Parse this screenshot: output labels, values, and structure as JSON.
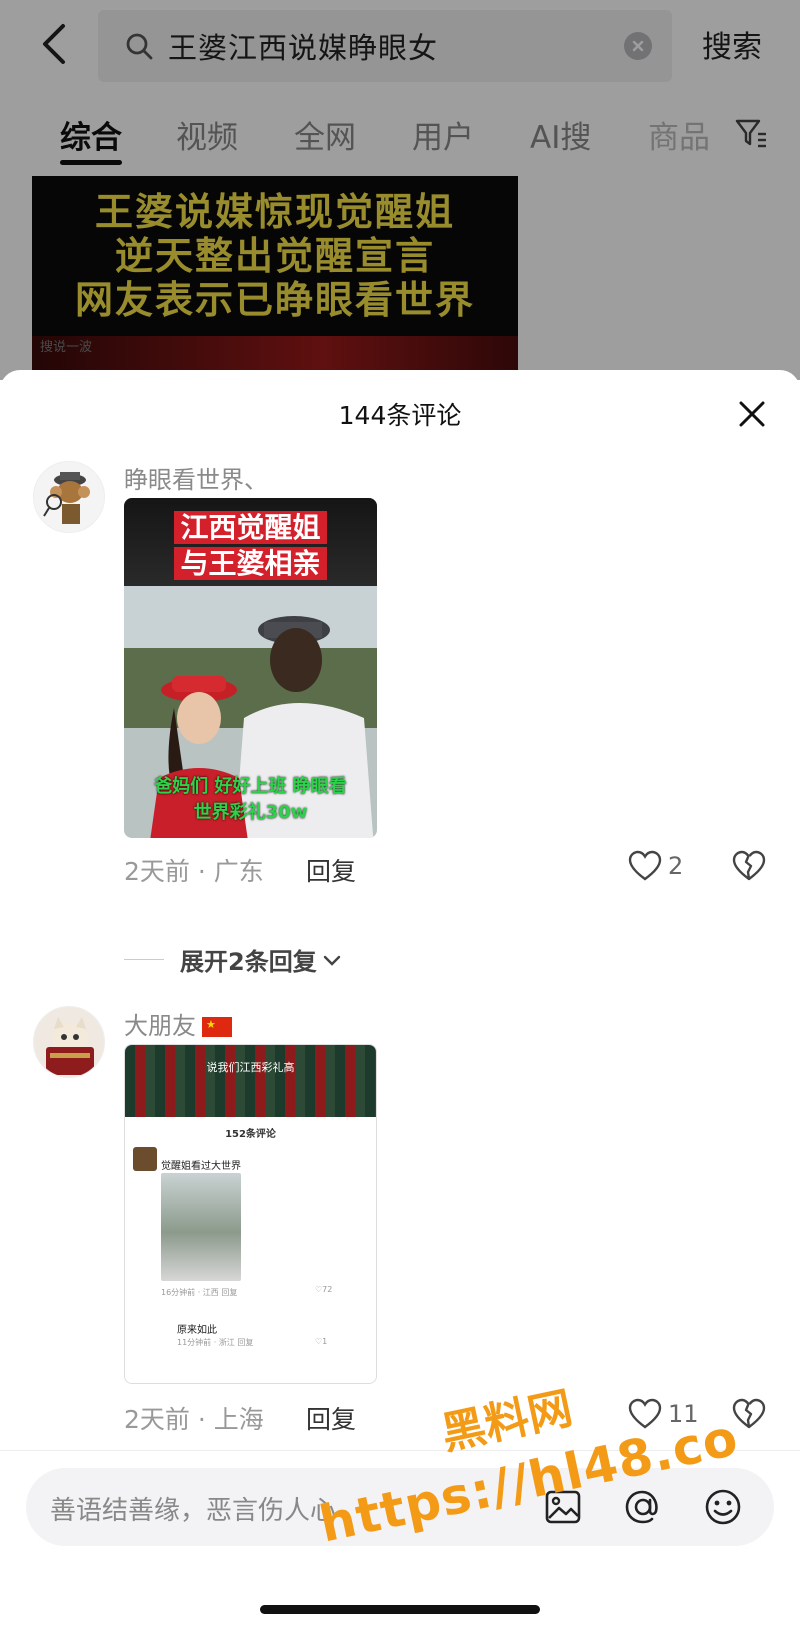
{
  "search": {
    "query": "王婆江西说媒睁眼女",
    "search_label": "搜索"
  },
  "tabs": [
    "综合",
    "视频",
    "全网",
    "用户",
    "AI搜",
    "商品"
  ],
  "video": {
    "lines": [
      "王婆说媒惊现觉醒姐",
      "逆天整出觉醒宣言",
      "网友表示已睁眼看世界"
    ],
    "small_tag": "搜说一波"
  },
  "comments_sheet": {
    "title": "144条评论",
    "comments": [
      {
        "username": "睁眼看世界、",
        "image_caption_top": "江西觉醒姐",
        "image_caption_bottom": "与王婆相亲",
        "image_overlay_line1": "爸妈们 好好上班   睁眼看",
        "image_overlay_line2": "世界彩礼30w",
        "time": "2天前",
        "location": "广东",
        "reply_label": "回复",
        "likes": "2",
        "expand_label": "展开2条回复"
      },
      {
        "username": "大朋友",
        "image_top_caption": "说我们江西彩礼高",
        "image_panel_title": "152条评论",
        "image_panel_comment": "觉醒姐看过大世界",
        "image_panel_meta": "16分钟前 · 江西  回复",
        "image_panel_reply": "原来如此",
        "image_panel_meta2": "11分钟前 · 浙江  回复",
        "image_panel_likes1": "72",
        "image_panel_likes2": "1",
        "time": "2天前",
        "location": "上海",
        "reply_label": "回复",
        "likes": "11"
      }
    ]
  },
  "input": {
    "placeholder": "善语结善缘，恶言伤人心"
  },
  "watermark": {
    "line1": "黑料网",
    "line2": "https://hl48.co"
  },
  "colors": {
    "watermark": "#f39b17",
    "video_caption": "#f7e34a",
    "flag_red": "#de2910"
  }
}
